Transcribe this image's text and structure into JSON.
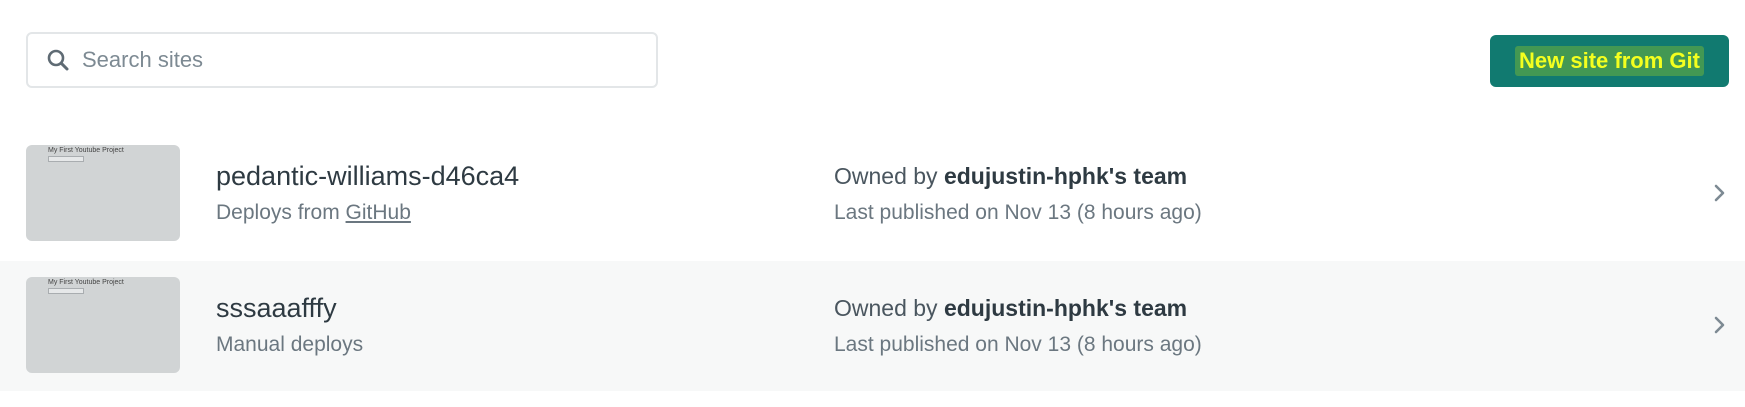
{
  "search": {
    "placeholder": "Search sites",
    "value": ""
  },
  "toolbar": {
    "new_site_label": "New site from Git",
    "accent_color": "#117a70",
    "highlight_color": "#f4ff1f"
  },
  "sites": [
    {
      "name": "pedantic-williams-d46ca4",
      "deploy_prefix": "Deploys from ",
      "deploy_link": "GitHub",
      "deploy_text": "",
      "owner_prefix": "Owned by ",
      "owner_team": "edujustin-hphk's team",
      "published": "Last published on Nov 13 (8 hours ago)",
      "thumbnail_title": "My First Youtube Project"
    },
    {
      "name": "sssaaafffy",
      "deploy_prefix": "",
      "deploy_link": "",
      "deploy_text": "Manual deploys",
      "owner_prefix": "Owned by ",
      "owner_team": "edujustin-hphk's team",
      "published": "Last published on Nov 13 (8 hours ago)",
      "thumbnail_title": "My First Youtube Project"
    }
  ],
  "icons": {
    "search": "search-icon",
    "chevron": "chevron-right-icon"
  }
}
